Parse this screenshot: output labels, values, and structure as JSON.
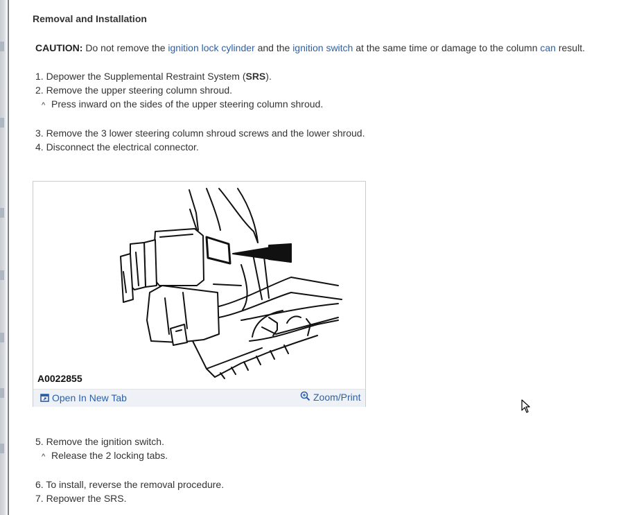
{
  "section_title": "Removal and Installation",
  "caution": {
    "label": "CAUTION:",
    "t1": " Do not remove the ",
    "link1": "ignition lock cylinder",
    "t2": " and the ",
    "link2": "ignition switch",
    "t3": " at the same time or damage to the column ",
    "link3": "can",
    "t4": " result."
  },
  "steps_a": {
    "s1_prefix": "1. Depower the Supplemental Restraint System (",
    "s1_bold": "SRS",
    "s1_suffix": ").",
    "s2": "2. Remove the upper steering column shroud.",
    "s2_sub": "Press inward on the sides of the upper steering column shroud.",
    "s3": "3. Remove the 3 lower steering column shroud screws and the lower shroud.",
    "s4": "4. Disconnect the electrical connector."
  },
  "figure": {
    "label": "A0022855",
    "open_tab": "Open In New Tab",
    "zoom": "Zoom/Print"
  },
  "steps_b": {
    "s5": "5. Remove the ignition switch.",
    "s5_sub": "Release the 2 locking tabs.",
    "s6": "6. To install, reverse the removal procedure.",
    "s7": "7. Repower the SRS."
  },
  "bullet_glyph": "^",
  "colors": {
    "link": "#2c5fa8",
    "text": "#333333",
    "figure_bar": "#eef1f5"
  },
  "icons": [
    "open-new-tab-icon",
    "zoom-icon",
    "mouse-cursor-icon"
  ]
}
